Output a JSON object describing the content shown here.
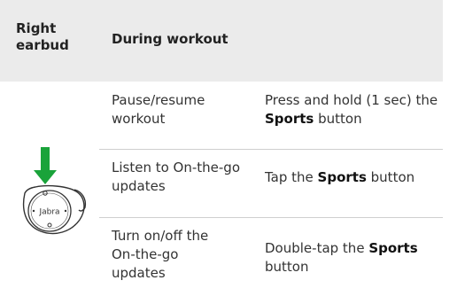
{
  "header": {
    "col1": "Right earbud",
    "col2": "During workout"
  },
  "rows": [
    {
      "action": "Pause/resume workout",
      "how": {
        "pre": "Press and hold (1 sec) the ",
        "button": "Sports",
        "post": " button"
      }
    },
    {
      "action": "Listen to On-the-go updates",
      "how": {
        "pre": "Tap the ",
        "button": "Sports",
        "post": " button"
      }
    },
    {
      "action": "Turn on/off the On-the-go updates",
      "how": {
        "pre": "Double-tap the ",
        "button": "Sports",
        "post": " button"
      }
    }
  ],
  "earbud": {
    "brand": "Jabra",
    "arrow_color": "#1aa33a"
  },
  "colors": {
    "header_bg": "#ebebeb",
    "divider": "#cfcfcf"
  }
}
